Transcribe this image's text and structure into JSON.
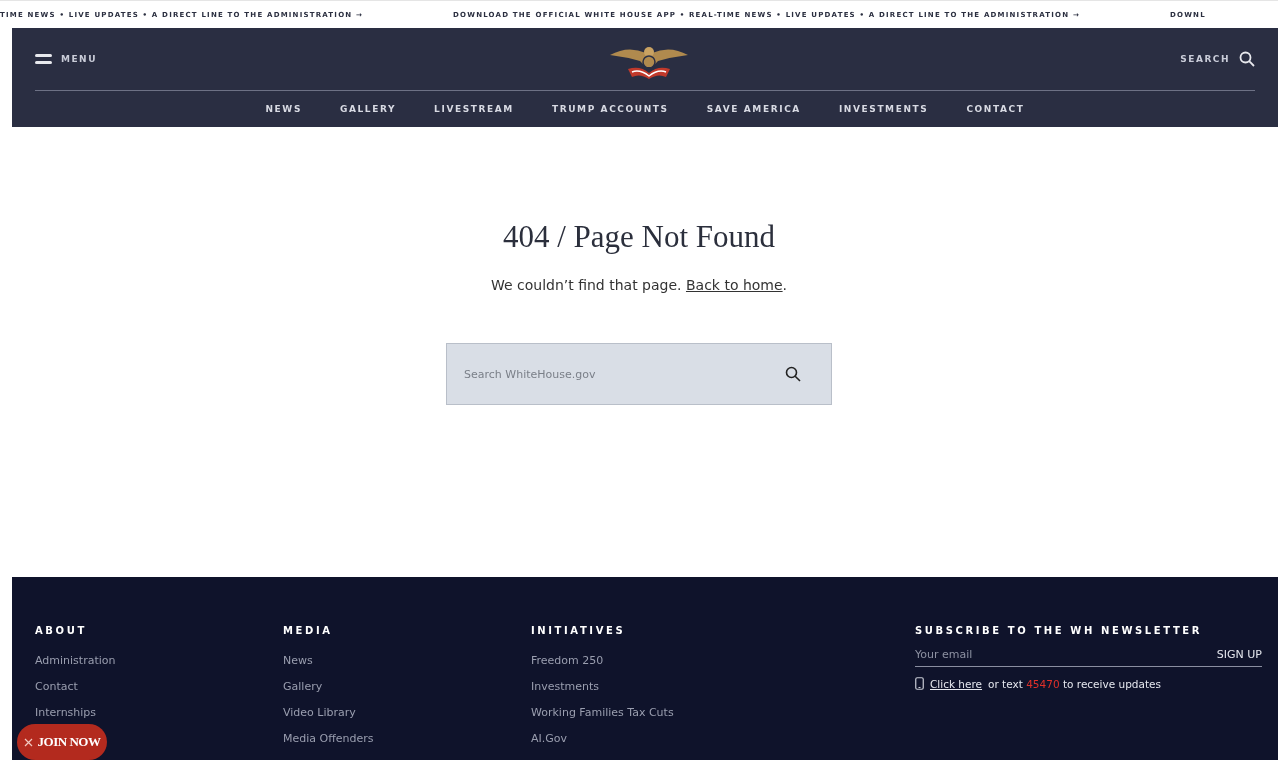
{
  "ticker": [
    "TIME NEWS • LIVE UPDATES • A DIRECT LINE TO THE ADMINISTRATION →",
    "DOWNLOAD THE OFFICIAL WHITE HOUSE APP • REAL-TIME NEWS • LIVE UPDATES • A DIRECT LINE TO THE ADMINISTRATION →",
    "DOWNL"
  ],
  "header": {
    "menu": "MENU",
    "search": "SEARCH",
    "nav": [
      "NEWS",
      "GALLERY",
      "LIVESTREAM",
      "TRUMP ACCOUNTS",
      "SAVE AMERICA",
      "INVESTMENTS",
      "CONTACT"
    ]
  },
  "main": {
    "title": "404 / Page Not Found",
    "message": "We couldn’t find that page.",
    "link": "Back to home",
    "after_link": ".",
    "search": {
      "placeholder": "Search WhiteHouse.gov"
    }
  },
  "footer": {
    "columns": [
      {
        "heading": "ABOUT",
        "links": [
          "Administration",
          "Contact",
          "Internships"
        ]
      },
      {
        "heading": "MEDIA",
        "links": [
          "News",
          "Gallery",
          "Video Library",
          "Media Offenders"
        ]
      },
      {
        "heading": "INITIATIVES",
        "links": [
          "Freedom 250",
          "Investments",
          "Working Families Tax Cuts",
          "AI.Gov"
        ]
      }
    ],
    "newsletter": {
      "heading": "SUBSCRIBE TO THE WH NEWSLETTER",
      "placeholder": "Your email",
      "button": "SIGN UP",
      "link": "Click here",
      "text_before": "or text",
      "number": "45470",
      "text_after": "to receive updates"
    }
  },
  "join_button": "JOIN NOW"
}
